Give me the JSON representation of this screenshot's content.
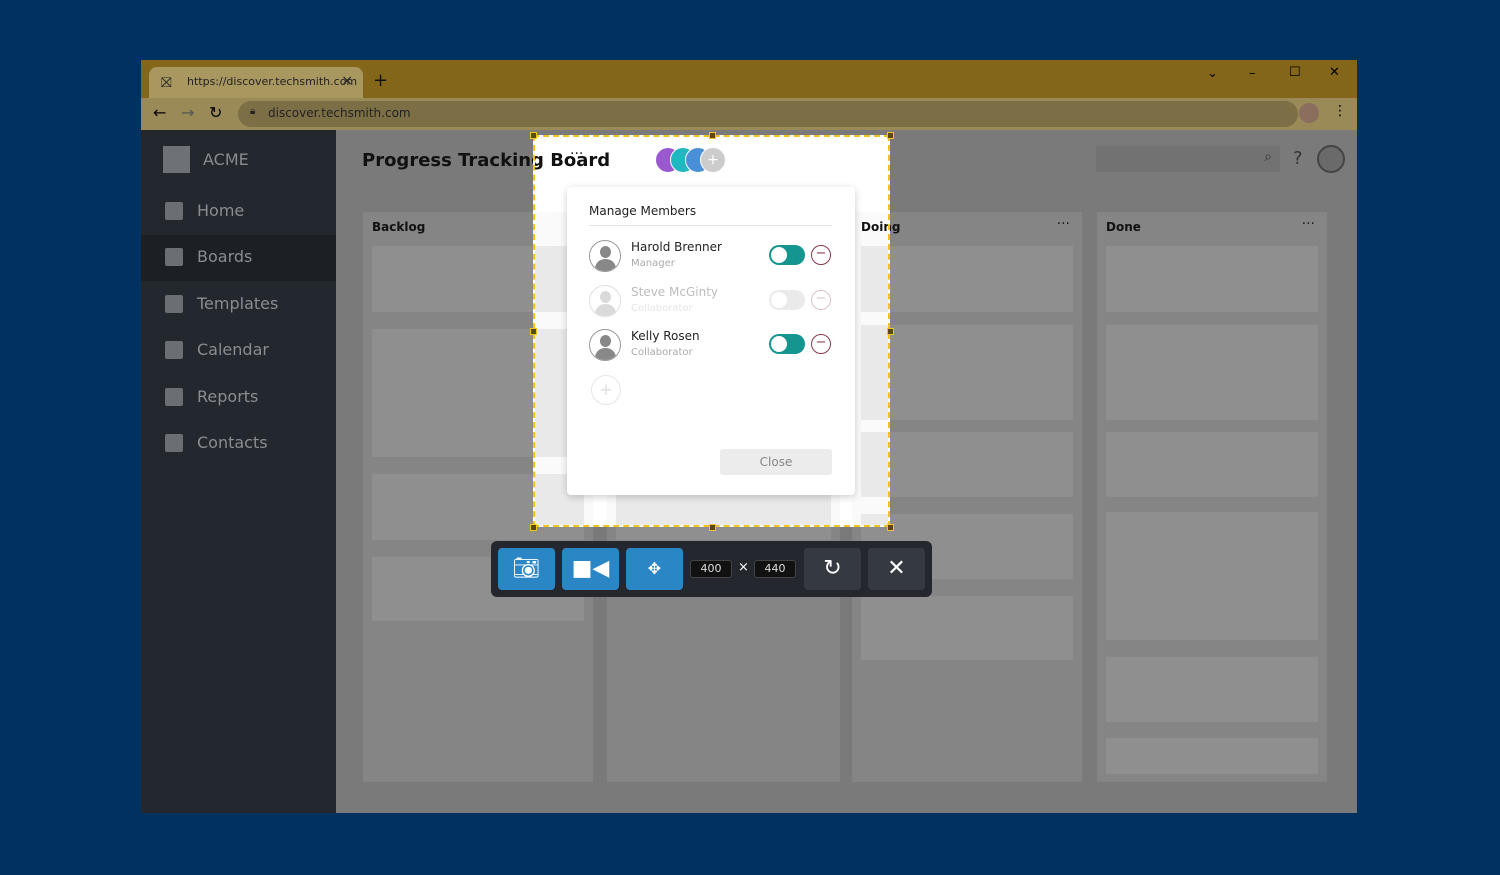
{
  "browser": {
    "tab_title": "https://discover.techsmith.com",
    "url": "discover.techsmith.com",
    "new_tab": "+",
    "close_tab": "×",
    "window_controls": [
      "⌄",
      "–",
      "☐",
      "✕"
    ]
  },
  "app": {
    "logo": "ACME",
    "title": "Progress Tracking Board",
    "title_menu": "···",
    "help": "?"
  },
  "sidebar": {
    "items": [
      {
        "label": "Home",
        "icon": "home-icon"
      },
      {
        "label": "Boards",
        "icon": "clipboard-icon",
        "active": true
      },
      {
        "label": "Templates",
        "icon": "templates-icon"
      },
      {
        "label": "Calendar",
        "icon": "calendar-icon"
      },
      {
        "label": "Reports",
        "icon": "reports-icon"
      },
      {
        "label": "Contacts",
        "icon": "contacts-icon"
      }
    ]
  },
  "columns": [
    {
      "title": "Backlog"
    },
    {
      "title": ""
    },
    {
      "title": "Doing",
      "menu": "···"
    },
    {
      "title": "Done",
      "menu": "···"
    }
  ],
  "members_dialog": {
    "title": "Manage Members",
    "close_label": "Close",
    "members": [
      {
        "name": "Harold Brenner",
        "role": "Manager",
        "enabled": true
      },
      {
        "name": "Steve McGinty",
        "role": "Collaborator",
        "enabled": false
      },
      {
        "name": "Kelly Rosen",
        "role": "Collaborator",
        "enabled": true
      }
    ]
  },
  "avatar_colors": [
    "#9b59d0",
    "#20b8c0",
    "#4a90d9",
    "#cccccc"
  ],
  "capture_toolbar": {
    "width": "400",
    "height": "440",
    "times": "×"
  },
  "colors": {
    "accent": "#2b86c5",
    "toggle": "#14958f",
    "selection": "#f0c419"
  }
}
